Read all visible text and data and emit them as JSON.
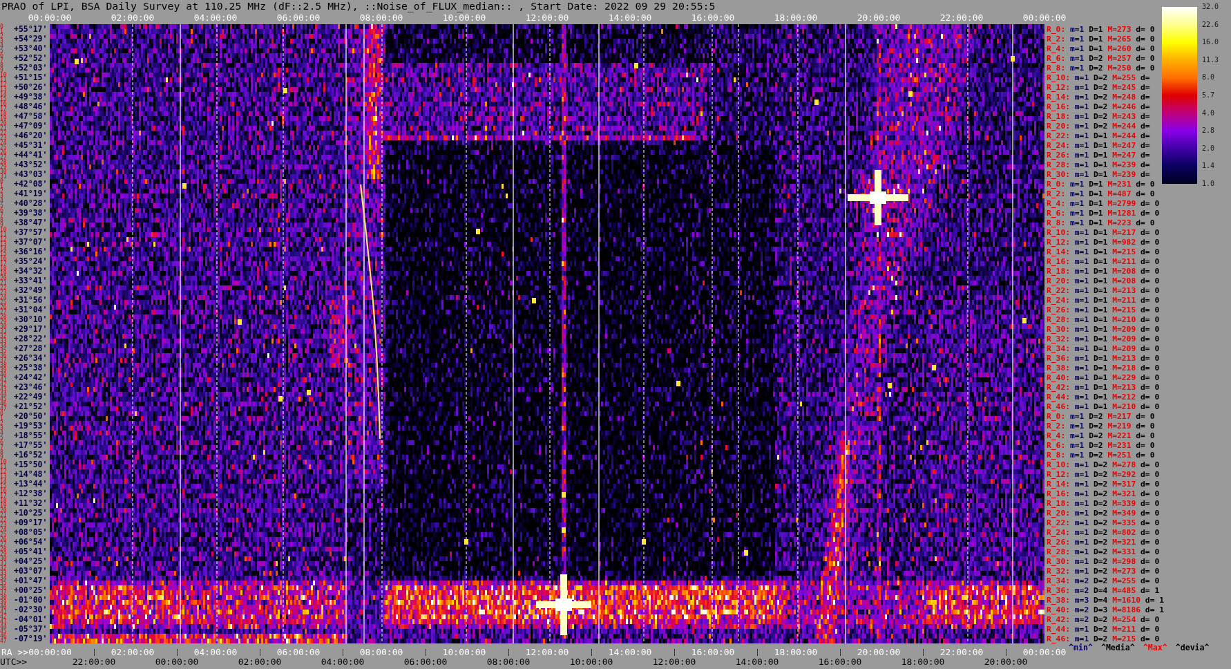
{
  "title": "PRAO of LPI, BSA Daily Survey at 110.25 MHz (dF::2.5 MHz), ::Noise_of_FLUX_median:: , Start Date: 2022 09 29 20:55:5",
  "top_axis": {
    "ticks": [
      "00:00:00",
      "02:00:00",
      "04:00:00",
      "06:00:00",
      "08:00:00",
      "10:00:00",
      "12:00:00",
      "14:00:00",
      "16:00:00",
      "18:00:00",
      "20:00:00",
      "22:00:00",
      "00:00:00"
    ]
  },
  "declination_rows": [
    {
      "beams": [
        "0",
        "1"
      ],
      "dec": "+55°17'"
    },
    {
      "beams": [
        "2",
        "3"
      ],
      "dec": "+54°29'"
    },
    {
      "beams": [
        "4",
        "5"
      ],
      "dec": "+53°40'"
    },
    {
      "beams": [
        "6",
        "7"
      ],
      "dec": "+52°52'"
    },
    {
      "beams": [
        "8",
        "9"
      ],
      "dec": "+52°03'"
    },
    {
      "beams": [
        "10",
        "11"
      ],
      "dec": "+51°15'"
    },
    {
      "beams": [
        "12",
        "13"
      ],
      "dec": "+50°26'"
    },
    {
      "beams": [
        "14",
        "15"
      ],
      "dec": "+49°38'"
    },
    {
      "beams": [
        "16",
        "17"
      ],
      "dec": "+48°46'"
    },
    {
      "beams": [
        "18",
        "19"
      ],
      "dec": "+47°58'"
    },
    {
      "beams": [
        "20",
        "21"
      ],
      "dec": "+47°09'"
    },
    {
      "beams": [
        "22",
        "23"
      ],
      "dec": "+46°20'"
    },
    {
      "beams": [
        "24",
        "25"
      ],
      "dec": "+45°31'"
    },
    {
      "beams": [
        "26",
        "27"
      ],
      "dec": "+44°41'"
    },
    {
      "beams": [
        "28",
        "29"
      ],
      "dec": "+43°52'"
    },
    {
      "beams": [
        "30",
        "31"
      ],
      "dec": "+43°03'"
    },
    {
      "beams": [
        "0",
        "1"
      ],
      "dec": "+42°08'"
    },
    {
      "beams": [
        "2",
        "3"
      ],
      "dec": "+41°19'"
    },
    {
      "beams": [
        "4",
        "5"
      ],
      "dec": "+40°28'"
    },
    {
      "beams": [
        "6",
        "7"
      ],
      "dec": "+39°38'"
    },
    {
      "beams": [
        "8",
        "9"
      ],
      "dec": "+38°47'"
    },
    {
      "beams": [
        "10",
        "11"
      ],
      "dec": "+37°57'"
    },
    {
      "beams": [
        "12",
        "13"
      ],
      "dec": "+37°07'"
    },
    {
      "beams": [
        "14",
        "15"
      ],
      "dec": "+36°16'"
    },
    {
      "beams": [
        "16",
        "17"
      ],
      "dec": "+35°24'"
    },
    {
      "beams": [
        "18",
        "19"
      ],
      "dec": "+34°32'"
    },
    {
      "beams": [
        "20",
        "21"
      ],
      "dec": "+33°41'"
    },
    {
      "beams": [
        "22",
        "23"
      ],
      "dec": "+32°49'"
    },
    {
      "beams": [
        "24",
        "25"
      ],
      "dec": "+31°56'"
    },
    {
      "beams": [
        "26",
        "27"
      ],
      "dec": "+31°04'"
    },
    {
      "beams": [
        "28",
        "29"
      ],
      "dec": "+30°10'"
    },
    {
      "beams": [
        "30",
        "31"
      ],
      "dec": "+29°17'"
    },
    {
      "beams": [
        "32",
        "33"
      ],
      "dec": "+28°22'"
    },
    {
      "beams": [
        "34",
        "35"
      ],
      "dec": "+27°28'"
    },
    {
      "beams": [
        "36",
        "37"
      ],
      "dec": "+26°34'"
    },
    {
      "beams": [
        "38",
        "39"
      ],
      "dec": "+25°38'"
    },
    {
      "beams": [
        "40",
        "41"
      ],
      "dec": "+24°42'"
    },
    {
      "beams": [
        "42",
        "43"
      ],
      "dec": "+23°46'"
    },
    {
      "beams": [
        "44",
        "45"
      ],
      "dec": "+22°49'"
    },
    {
      "beams": [
        "46",
        "47"
      ],
      "dec": "+21°52'"
    },
    {
      "beams": [
        "0",
        "1"
      ],
      "dec": "+20°50'"
    },
    {
      "beams": [
        "2",
        "3"
      ],
      "dec": "+19°53'"
    },
    {
      "beams": [
        "4",
        "5"
      ],
      "dec": "+18°55'"
    },
    {
      "beams": [
        "6",
        "7"
      ],
      "dec": "+17°55'"
    },
    {
      "beams": [
        "8",
        "9"
      ],
      "dec": "+16°52'"
    },
    {
      "beams": [
        "10",
        "11"
      ],
      "dec": "+15°50'"
    },
    {
      "beams": [
        "12",
        "13"
      ],
      "dec": "+14°48'"
    },
    {
      "beams": [
        "14",
        "15"
      ],
      "dec": "+13°44'"
    },
    {
      "beams": [
        "16",
        "17"
      ],
      "dec": "+12°38'"
    },
    {
      "beams": [
        "18",
        "19"
      ],
      "dec": "+11°32'"
    },
    {
      "beams": [
        "20",
        "21"
      ],
      "dec": "+10°25'"
    },
    {
      "beams": [
        "22",
        "23"
      ],
      "dec": "+09°17'"
    },
    {
      "beams": [
        "24",
        "25"
      ],
      "dec": "+08°05'"
    },
    {
      "beams": [
        "26",
        "27"
      ],
      "dec": "+06°54'"
    },
    {
      "beams": [
        "28",
        "29"
      ],
      "dec": "+05°41'"
    },
    {
      "beams": [
        "30",
        "31"
      ],
      "dec": "+04°25'"
    },
    {
      "beams": [
        "32",
        "33"
      ],
      "dec": "+03°07'"
    },
    {
      "beams": [
        "34",
        "35"
      ],
      "dec": "+01°47'"
    },
    {
      "beams": [
        "36",
        "37"
      ],
      "dec": "+00°25'"
    },
    {
      "beams": [
        "38",
        "39"
      ],
      "dec": "-01°00'"
    },
    {
      "beams": [
        "40",
        "41"
      ],
      "dec": "-02°30'"
    },
    {
      "beams": [
        "42",
        "43"
      ],
      "dec": "-04°01'"
    },
    {
      "beams": [
        "44",
        "45"
      ],
      "dec": "-05°37'"
    },
    {
      "beams": [
        "46",
        "47"
      ],
      "dec": "-07°19'"
    }
  ],
  "beam_stats": [
    {
      "beam": "R_0:",
      "min": "m=1",
      "median": "D=1",
      "max": "M=273",
      "dev": "d= 0"
    },
    {
      "beam": "R_2:",
      "min": "m=1",
      "median": "D=1",
      "max": "M=265",
      "dev": "d= 0"
    },
    {
      "beam": "R_4:",
      "min": "m=1",
      "median": "D=1",
      "max": "M=260",
      "dev": "d= 0"
    },
    {
      "beam": "R_6:",
      "min": "m=1",
      "median": "D=2",
      "max": "M=257",
      "dev": "d= 0"
    },
    {
      "beam": "R_8:",
      "min": "m=1",
      "median": "D=2",
      "max": "M=250",
      "dev": "d= 0"
    },
    {
      "beam": "R_10:",
      "min": "m=1",
      "median": "D=2",
      "max": "M=255",
      "dev": "d="
    },
    {
      "beam": "R_12:",
      "min": "m=1",
      "median": "D=2",
      "max": "M=245",
      "dev": "d="
    },
    {
      "beam": "R_14:",
      "min": "m=1",
      "median": "D=2",
      "max": "M=248",
      "dev": "d="
    },
    {
      "beam": "R_16:",
      "min": "m=1",
      "median": "D=2",
      "max": "M=246",
      "dev": "d="
    },
    {
      "beam": "R_18:",
      "min": "m=1",
      "median": "D=2",
      "max": "M=243",
      "dev": "d="
    },
    {
      "beam": "R_20:",
      "min": "m=1",
      "median": "D=2",
      "max": "M=244",
      "dev": "d="
    },
    {
      "beam": "R_22:",
      "min": "m=1",
      "median": "D=1",
      "max": "M=244",
      "dev": "d="
    },
    {
      "beam": "R_24:",
      "min": "m=1",
      "median": "D=1",
      "max": "M=247",
      "dev": "d="
    },
    {
      "beam": "R_26:",
      "min": "m=1",
      "median": "D=1",
      "max": "M=247",
      "dev": "d="
    },
    {
      "beam": "R_28:",
      "min": "m=1",
      "median": "D=1",
      "max": "M=239",
      "dev": "d="
    },
    {
      "beam": "R_30:",
      "min": "m=1",
      "median": "D=1",
      "max": "M=239",
      "dev": "d="
    },
    {
      "beam": "R_0:",
      "min": "m=1",
      "median": "D=1",
      "max": "M=231",
      "dev": "d= 0"
    },
    {
      "beam": "R_2:",
      "min": "m=1",
      "median": "D=1",
      "max": "M=487",
      "dev": "d= 0"
    },
    {
      "beam": "R_4:",
      "min": "m=1",
      "median": "D=1",
      "max": "M=2799",
      "dev": "d= 0"
    },
    {
      "beam": "R_6:",
      "min": "m=1",
      "median": "D=1",
      "max": "M=1281",
      "dev": "d= 0"
    },
    {
      "beam": "R_8:",
      "min": "m=1",
      "median": "D=1",
      "max": "M=223",
      "dev": "d= 0"
    },
    {
      "beam": "R_10:",
      "min": "m=1",
      "median": "D=1",
      "max": "M=217",
      "dev": "d= 0"
    },
    {
      "beam": "R_12:",
      "min": "m=1",
      "median": "D=1",
      "max": "M=982",
      "dev": "d= 0"
    },
    {
      "beam": "R_14:",
      "min": "m=1",
      "median": "D=1",
      "max": "M=215",
      "dev": "d= 0"
    },
    {
      "beam": "R_16:",
      "min": "m=1",
      "median": "D=1",
      "max": "M=211",
      "dev": "d= 0"
    },
    {
      "beam": "R_18:",
      "min": "m=1",
      "median": "D=1",
      "max": "M=208",
      "dev": "d= 0"
    },
    {
      "beam": "R_20:",
      "min": "m=1",
      "median": "D=1",
      "max": "M=208",
      "dev": "d= 0"
    },
    {
      "beam": "R_22:",
      "min": "m=1",
      "median": "D=1",
      "max": "M=213",
      "dev": "d= 0"
    },
    {
      "beam": "R_24:",
      "min": "m=1",
      "median": "D=1",
      "max": "M=211",
      "dev": "d= 0"
    },
    {
      "beam": "R_26:",
      "min": "m=1",
      "median": "D=1",
      "max": "M=215",
      "dev": "d= 0"
    },
    {
      "beam": "R_28:",
      "min": "m=1",
      "median": "D=1",
      "max": "M=210",
      "dev": "d= 0"
    },
    {
      "beam": "R_30:",
      "min": "m=1",
      "median": "D=1",
      "max": "M=209",
      "dev": "d= 0"
    },
    {
      "beam": "R_32:",
      "min": "m=1",
      "median": "D=1",
      "max": "M=209",
      "dev": "d= 0"
    },
    {
      "beam": "R_34:",
      "min": "m=1",
      "median": "D=1",
      "max": "M=209",
      "dev": "d= 0"
    },
    {
      "beam": "R_36:",
      "min": "m=1",
      "median": "D=1",
      "max": "M=213",
      "dev": "d= 0"
    },
    {
      "beam": "R_38:",
      "min": "m=1",
      "median": "D=1",
      "max": "M=218",
      "dev": "d= 0"
    },
    {
      "beam": "R_40:",
      "min": "m=1",
      "median": "D=1",
      "max": "M=229",
      "dev": "d= 0"
    },
    {
      "beam": "R_42:",
      "min": "m=1",
      "median": "D=1",
      "max": "M=213",
      "dev": "d= 0"
    },
    {
      "beam": "R_44:",
      "min": "m=1",
      "median": "D=1",
      "max": "M=212",
      "dev": "d= 0"
    },
    {
      "beam": "R_46:",
      "min": "m=1",
      "median": "D=1",
      "max": "M=210",
      "dev": "d= 0"
    },
    {
      "beam": "R_0:",
      "min": "m=1",
      "median": "D=2",
      "max": "M=217",
      "dev": "d= 0"
    },
    {
      "beam": "R_2:",
      "min": "m=1",
      "median": "D=2",
      "max": "M=219",
      "dev": "d= 0"
    },
    {
      "beam": "R_4:",
      "min": "m=1",
      "median": "D=2",
      "max": "M=221",
      "dev": "d= 0"
    },
    {
      "beam": "R_6:",
      "min": "m=1",
      "median": "D=2",
      "max": "M=231",
      "dev": "d= 0"
    },
    {
      "beam": "R_8:",
      "min": "m=1",
      "median": "D=2",
      "max": "M=251",
      "dev": "d= 0"
    },
    {
      "beam": "R_10:",
      "min": "m=1",
      "median": "D=2",
      "max": "M=278",
      "dev": "d= 0"
    },
    {
      "beam": "R_12:",
      "min": "m=1",
      "median": "D=2",
      "max": "M=292",
      "dev": "d= 0"
    },
    {
      "beam": "R_14:",
      "min": "m=1",
      "median": "D=2",
      "max": "M=317",
      "dev": "d= 0"
    },
    {
      "beam": "R_16:",
      "min": "m=1",
      "median": "D=2",
      "max": "M=321",
      "dev": "d= 0"
    },
    {
      "beam": "R_18:",
      "min": "m=1",
      "median": "D=2",
      "max": "M=339",
      "dev": "d= 0"
    },
    {
      "beam": "R_20:",
      "min": "m=1",
      "median": "D=2",
      "max": "M=349",
      "dev": "d= 0"
    },
    {
      "beam": "R_22:",
      "min": "m=1",
      "median": "D=2",
      "max": "M=335",
      "dev": "d= 0"
    },
    {
      "beam": "R_24:",
      "min": "m=1",
      "median": "D=2",
      "max": "M=802",
      "dev": "d= 0"
    },
    {
      "beam": "R_26:",
      "min": "m=1",
      "median": "D=2",
      "max": "M=321",
      "dev": "d= 0"
    },
    {
      "beam": "R_28:",
      "min": "m=1",
      "median": "D=2",
      "max": "M=331",
      "dev": "d= 0"
    },
    {
      "beam": "R_30:",
      "min": "m=1",
      "median": "D=2",
      "max": "M=298",
      "dev": "d= 0"
    },
    {
      "beam": "R_32:",
      "min": "m=1",
      "median": "D=2",
      "max": "M=273",
      "dev": "d= 0"
    },
    {
      "beam": "R_34:",
      "min": "m=2",
      "median": "D=2",
      "max": "M=255",
      "dev": "d= 0"
    },
    {
      "beam": "R_36:",
      "min": "m=2",
      "median": "D=4",
      "max": "M=485",
      "dev": "d= 1"
    },
    {
      "beam": "R_38:",
      "min": "m=3",
      "median": "D=4",
      "max": "M=1610",
      "dev": "d= 1"
    },
    {
      "beam": "R_40:",
      "min": "m=2",
      "median": "D=3",
      "max": "M=8186",
      "dev": "d= 1"
    },
    {
      "beam": "R_42:",
      "min": "m=2",
      "median": "D=2",
      "max": "M=254",
      "dev": "d= 0"
    },
    {
      "beam": "R_44:",
      "min": "m=1",
      "median": "D=2",
      "max": "M=211",
      "dev": "d= 0"
    },
    {
      "beam": "R_46:",
      "min": "m=1",
      "median": "D=2",
      "max": "M=215",
      "dev": "d= 0"
    }
  ],
  "stats_legend": [
    {
      "kind": "min",
      "label": "^min^"
    },
    {
      "kind": "median",
      "label": "^Media^"
    },
    {
      "kind": "max",
      "label": "^Max^"
    },
    {
      "kind": "dev",
      "label": "^devia^"
    }
  ],
  "color_scale": {
    "ticks": [
      "32.0",
      "22.6",
      "16.0",
      "11.3",
      "8.0",
      "5.7",
      "4.0",
      "2.8",
      "2.0",
      "1.4",
      "1.0"
    ]
  },
  "ra_axis": {
    "label": "RA >>",
    "ticks": [
      "00:00:00",
      "02:00:00",
      "04:00:00",
      "06:00:00",
      "08:00:00",
      "10:00:00",
      "12:00:00",
      "14:00:00",
      "16:00:00",
      "18:00:00",
      "20:00:00",
      "22:00:00",
      "00:00:00"
    ]
  },
  "utc_axis": {
    "label": "UTC>>",
    "ticks": [
      "22:00:00",
      "00:00:00",
      "02:00:00",
      "04:00:00",
      "06:00:00",
      "08:00:00",
      "10:00:00",
      "12:00:00",
      "14:00:00",
      "16:00:00",
      "18:00:00",
      "20:00:00"
    ]
  }
}
